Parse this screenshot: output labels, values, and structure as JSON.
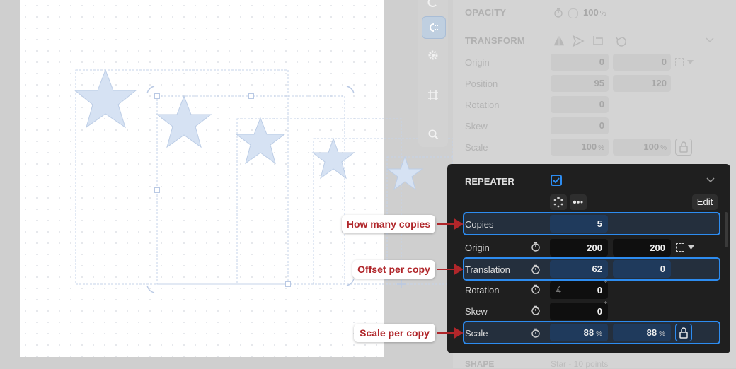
{
  "inspector_bg": {
    "opacity": {
      "label": "OPACITY",
      "value": "100",
      "unit": "%"
    },
    "transform": {
      "label": "TRANSFORM",
      "origin": {
        "label": "Origin",
        "x": "0",
        "y": "0"
      },
      "position": {
        "label": "Position",
        "x": "95",
        "y": "120"
      },
      "rotation": {
        "label": "Rotation",
        "value": "0",
        "unit": "°"
      },
      "skew": {
        "label": "Skew",
        "value": "0",
        "unit": "°"
      },
      "scale": {
        "label": "Scale",
        "x": "100",
        "y": "100",
        "unit": "%"
      }
    },
    "shape": {
      "label": "SHAPE",
      "value": "Star - 10 points"
    }
  },
  "repeater": {
    "title": "REPEATER",
    "edit_label": "Edit",
    "copies": {
      "label": "Copies",
      "value": "5"
    },
    "origin": {
      "label": "Origin",
      "x": "200",
      "y": "200"
    },
    "translation": {
      "label": "Translation",
      "x": "62",
      "y": "0"
    },
    "rotation": {
      "label": "Rotation",
      "value": "0",
      "unit": "°"
    },
    "skew": {
      "label": "Skew",
      "value": "0",
      "unit": "°"
    },
    "scale": {
      "label": "Scale",
      "x": "88",
      "y": "88",
      "unit": "%"
    }
  },
  "callouts": {
    "copies": "How many copies",
    "translation": "Offset per copy",
    "scale": "Scale per copy"
  },
  "colors": {
    "accent": "#2d8cf0",
    "callout_text": "#b0262a",
    "star_fill": "#d6e2f3",
    "panel_dark": "#1f1f1f"
  }
}
